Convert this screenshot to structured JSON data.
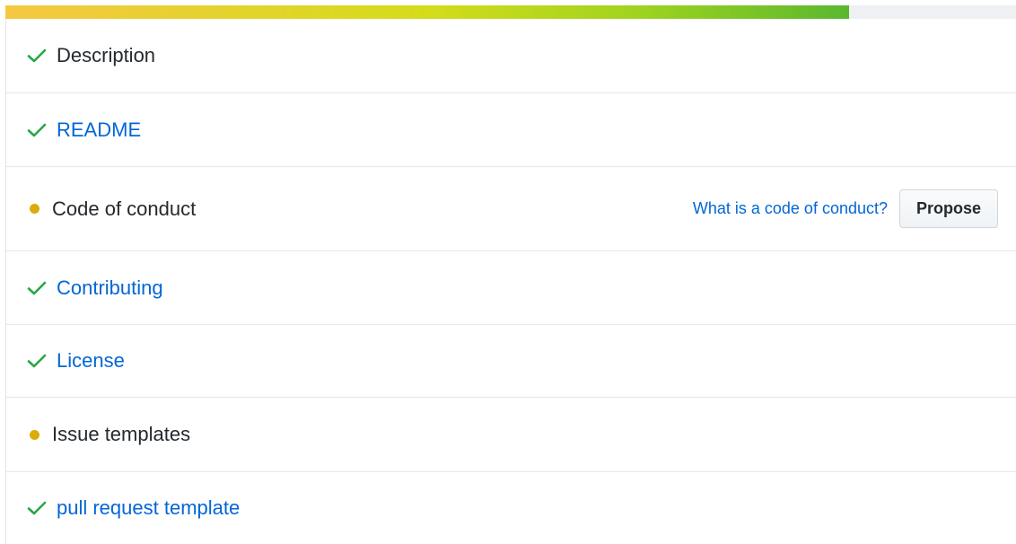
{
  "progress": {
    "fraction": 0.835
  },
  "colors": {
    "check": "#28a745",
    "dot": "#dbab09",
    "link": "#0366d6",
    "text": "#24292e"
  },
  "checklist": {
    "items": [
      {
        "label": "Description",
        "status": "complete",
        "icon": "check-icon"
      },
      {
        "label": "README",
        "status": "complete",
        "icon": "check-icon"
      },
      {
        "label": "Code of conduct",
        "status": "missing",
        "icon": "dot-icon",
        "help_link": "What is a code of conduct?",
        "action": "Propose"
      },
      {
        "label": "Contributing",
        "status": "complete",
        "icon": "check-icon"
      },
      {
        "label": "License",
        "status": "complete",
        "icon": "check-icon"
      },
      {
        "label": "Issue templates",
        "status": "missing",
        "icon": "dot-icon"
      },
      {
        "label": "pull request template",
        "status": "complete",
        "icon": "check-icon"
      }
    ]
  }
}
